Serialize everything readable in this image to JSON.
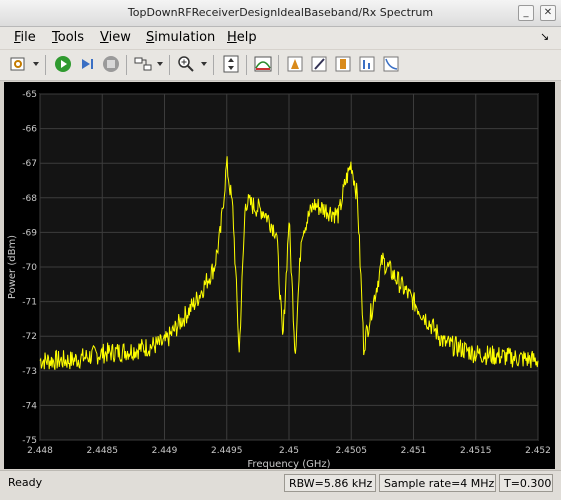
{
  "window": {
    "title": "TopDownRFReceiverDesignIdealBaseband/Rx Spectrum"
  },
  "menu": [
    {
      "label": "File",
      "key": "F"
    },
    {
      "label": "Tools",
      "key": "T"
    },
    {
      "label": "View",
      "key": "V"
    },
    {
      "label": "Simulation",
      "key": "S"
    },
    {
      "label": "Help",
      "key": "H"
    }
  ],
  "toolbar_icons": [
    "settings-icon",
    "run-icon",
    "step-forward-icon",
    "stop-icon",
    "highlight-block-icon",
    "zoom-in-icon",
    "scale-axes-icon",
    "spectrum-settings-icon",
    "peak-finder-icon",
    "cursor-measurements-icon",
    "channel-measurements-icon",
    "distortion-measurements-icon",
    "ccdf-icon"
  ],
  "chart_data": {
    "type": "line",
    "xlabel": "Frequency (GHz)",
    "ylabel": "Power (dBm)",
    "xlim": [
      2.448,
      2.452
    ],
    "ylim": [
      -75,
      -65
    ],
    "xticks": [
      "2.448",
      "2.4485",
      "2.449",
      "2.4495",
      "2.45",
      "2.4505",
      "2.451",
      "2.4515",
      "2.452"
    ],
    "yticks": [
      "-65",
      "-66",
      "-67",
      "-68",
      "-69",
      "-70",
      "-71",
      "-72",
      "-73",
      "-74",
      "-75"
    ],
    "grid": true,
    "series": [
      {
        "color": "#ffff00",
        "x": [
          2.448,
          2.44825,
          2.4485,
          2.44875,
          2.449,
          2.44925,
          2.4494,
          2.44945,
          2.4495,
          2.44955,
          2.4496,
          2.4498,
          2.4499,
          2.44995,
          2.45,
          2.45005,
          2.4501,
          2.4502,
          2.4504,
          2.44965,
          2.45045,
          2.4505,
          2.45055,
          2.4506,
          2.45075,
          2.451,
          2.45125,
          2.4515,
          2.45175,
          2.452
        ],
        "y": [
          -72.7,
          -72.7,
          -72.5,
          -72.4,
          -72.2,
          -71.0,
          -70.0,
          -69.0,
          -67.0,
          -68.4,
          -72.5,
          -68.4,
          -69.0,
          -72.2,
          -68.6,
          -72.5,
          -69.0,
          -68.2,
          -68.5,
          -68.1,
          -67.6,
          -67.0,
          -68.0,
          -72.3,
          -69.8,
          -71.0,
          -72.2,
          -72.5,
          -72.6,
          -72.7
        ]
      }
    ]
  },
  "status": {
    "ready": "Ready",
    "rbw": "RBW=5.86 kHz",
    "sample_rate": "Sample rate=4 MHz",
    "time": "T=0.300"
  },
  "colors": {
    "plot_bg": "#000000",
    "axes_bg": "#141414",
    "grid": "#3c3c3c",
    "trace": "#ffff00",
    "tick_text": "#c8c8c8"
  }
}
